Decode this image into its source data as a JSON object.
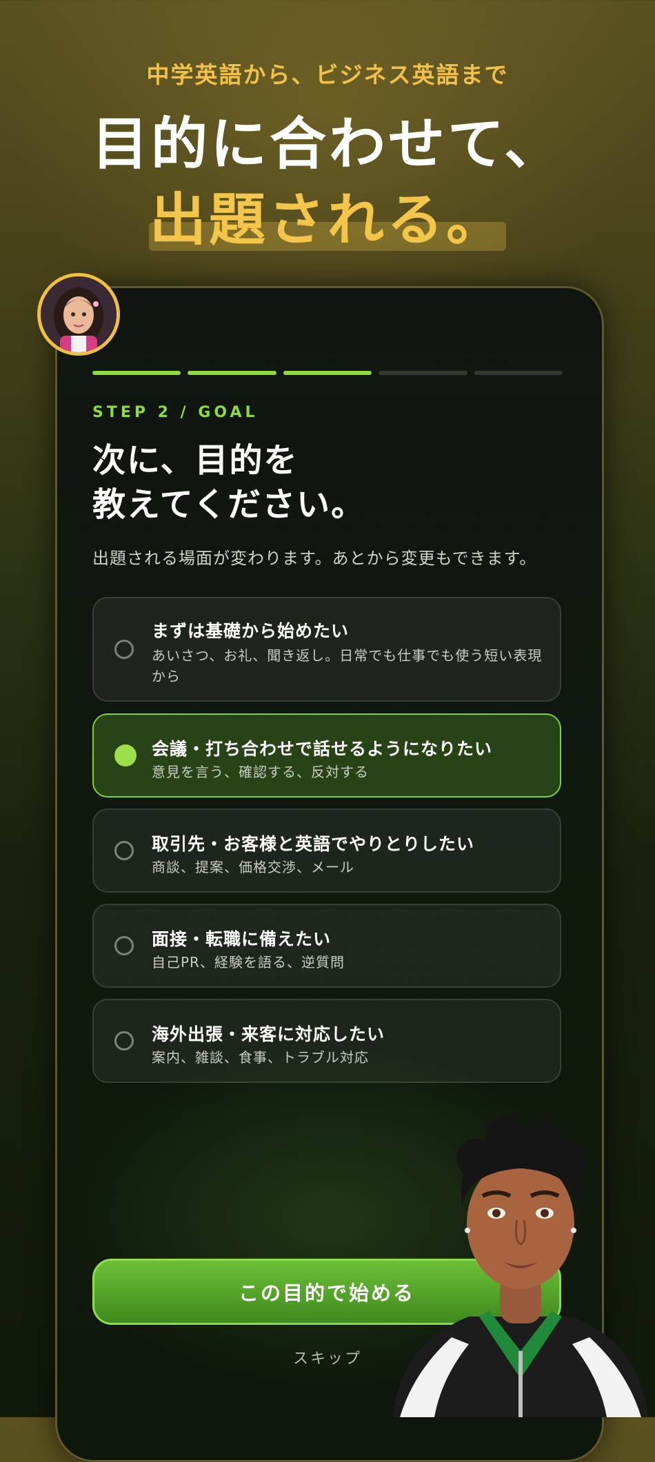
{
  "header": {
    "subtitle": "中学英語から、ビジネス英語まで",
    "headline_line1": "目的に合わせて、",
    "headline_line2": "出題される。"
  },
  "onboarding": {
    "progress": {
      "total_steps": 5,
      "completed_steps": 3
    },
    "step_label": "STEP 2 / GOAL",
    "question_line1": "次に、目的を",
    "question_line2": "教えてください。",
    "question_sub": "出題される場面が変わります。あとから変更もできます。",
    "options": [
      {
        "title": "まずは基礎から始めたい",
        "desc": "あいさつ、お礼、聞き返し。日常でも仕事でも使う短い表現から",
        "selected": false
      },
      {
        "title": "会議・打ち合わせで話せるようになりたい",
        "desc": "意見を言う、確認する、反対する",
        "selected": true
      },
      {
        "title": "取引先・お客様と英語でやりとりしたい",
        "desc": "商談、提案、価格交渉、メール",
        "selected": false
      },
      {
        "title": "面接・転職に備えたい",
        "desc": "自己PR、経験を語る、逆質問",
        "selected": false
      },
      {
        "title": "海外出張・来客に対応したい",
        "desc": "案内、雑談、食事、トラブル対応",
        "selected": false
      }
    ],
    "cta_label": "この目的で始める",
    "skip_label": "スキップ"
  },
  "colors": {
    "accent_green": "#8edb3c",
    "accent_yellow": "#f3c64a"
  }
}
